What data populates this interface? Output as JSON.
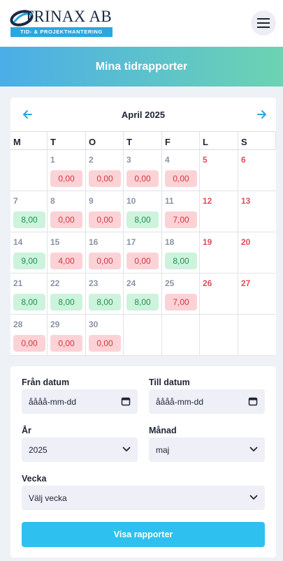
{
  "header": {
    "logo_name": "TRINAX AB",
    "logo_tagline": "TID- & PROJEKTHANTERING",
    "menu_icon": "hamburger-icon"
  },
  "banner": {
    "title": "Mina tidrapporter"
  },
  "calendar": {
    "month_title": "April 2025",
    "prev_icon": "arrow-left-icon",
    "next_icon": "arrow-right-icon",
    "weekdays": [
      "M",
      "T",
      "O",
      "T",
      "F",
      "L",
      "S"
    ],
    "weeks": [
      [
        null,
        {
          "day": "1",
          "hours": "0,00",
          "status": "red"
        },
        {
          "day": "2",
          "hours": "0,00",
          "status": "red"
        },
        {
          "day": "3",
          "hours": "0,00",
          "status": "red"
        },
        {
          "day": "4",
          "hours": "0,00",
          "status": "red"
        },
        {
          "day": "5",
          "weekend": true
        },
        {
          "day": "6",
          "weekend": true
        }
      ],
      [
        {
          "day": "7",
          "hours": "8,00",
          "status": "green"
        },
        {
          "day": "8",
          "hours": "0,00",
          "status": "red"
        },
        {
          "day": "9",
          "hours": "0,00",
          "status": "red"
        },
        {
          "day": "10",
          "hours": "8,00",
          "status": "green"
        },
        {
          "day": "11",
          "hours": "7,00",
          "status": "red"
        },
        {
          "day": "12",
          "weekend": true
        },
        {
          "day": "13",
          "weekend": true
        }
      ],
      [
        {
          "day": "14",
          "hours": "9,00",
          "status": "green"
        },
        {
          "day": "15",
          "hours": "4,00",
          "status": "red"
        },
        {
          "day": "16",
          "hours": "0,00",
          "status": "red"
        },
        {
          "day": "17",
          "hours": "0,00",
          "status": "red"
        },
        {
          "day": "18",
          "hours": "8,00",
          "status": "green"
        },
        {
          "day": "19",
          "weekend": true
        },
        {
          "day": "20",
          "weekend": true
        }
      ],
      [
        {
          "day": "21",
          "hours": "8,00",
          "status": "green"
        },
        {
          "day": "22",
          "hours": "8,00",
          "status": "green"
        },
        {
          "day": "23",
          "hours": "8,00",
          "status": "green"
        },
        {
          "day": "24",
          "hours": "8,00",
          "status": "green"
        },
        {
          "day": "25",
          "hours": "7,00",
          "status": "red"
        },
        {
          "day": "26",
          "weekend": true
        },
        {
          "day": "27",
          "weekend": true
        }
      ],
      [
        {
          "day": "28",
          "hours": "0,00",
          "status": "red"
        },
        {
          "day": "29",
          "hours": "0,00",
          "status": "red"
        },
        {
          "day": "30",
          "hours": "0,00",
          "status": "red"
        },
        null,
        null,
        null,
        null
      ]
    ]
  },
  "form": {
    "from_date": {
      "label": "Från datum",
      "placeholder": "åååå-mm-dd",
      "icon": "calendar-icon"
    },
    "to_date": {
      "label": "Till datum",
      "placeholder": "åååå-mm-dd",
      "icon": "calendar-icon"
    },
    "year": {
      "label": "År",
      "value": "2025",
      "icon": "chevron-down-icon"
    },
    "month": {
      "label": "Månad",
      "value": "maj",
      "icon": "chevron-down-icon"
    },
    "week": {
      "label": "Vecka",
      "value": "Välj vecka",
      "icon": "chevron-down-icon"
    },
    "submit_label": "Visa rapporter"
  },
  "colors": {
    "accent": "#2ec0ee",
    "banner_start": "#4aaee8",
    "banner_end": "#6dd3b2",
    "deficit_bg": "#fbd3d7",
    "deficit_text": "#d7323f",
    "ok_bg": "#cdf3dd",
    "ok_text": "#1f9150",
    "weekend_text": "#e24b5c"
  }
}
